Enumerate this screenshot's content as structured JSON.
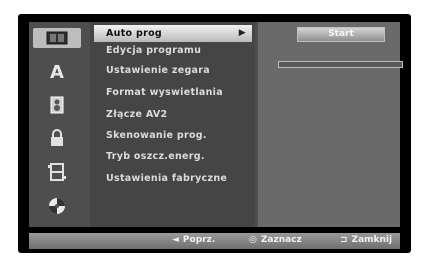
{
  "icons": [
    {
      "name": "disc-icon",
      "glyph": "▥",
      "selected": true
    },
    {
      "name": "language-icon",
      "glyph": "A",
      "selected": false
    },
    {
      "name": "audio-icon",
      "glyph": "♪",
      "selected": false
    },
    {
      "name": "lock-icon",
      "glyph": "🔒",
      "selected": false
    },
    {
      "name": "recording-icon",
      "glyph": "⧉",
      "selected": false
    },
    {
      "name": "dvd-icon",
      "glyph": "⊛",
      "selected": false
    }
  ],
  "menu": {
    "items": [
      {
        "label": "Auto prog",
        "selected": true
      },
      {
        "label": "Edycja programu",
        "selected": false
      },
      {
        "label": "Ustawienie zegara",
        "selected": false
      },
      {
        "label": "Format wyswietlania",
        "selected": false
      },
      {
        "label": "Złącze AV2",
        "selected": false
      },
      {
        "label": "Skenowanie prog.",
        "selected": false
      },
      {
        "label": "Tryb oszcz.energ.",
        "selected": false
      },
      {
        "label": "Ustawienia fabryczne",
        "selected": false
      }
    ],
    "submenu_arrow": "▶"
  },
  "right": {
    "start_label": "Start",
    "progress": 0
  },
  "bottom": {
    "prev_symbol": "◄",
    "prev_label": "Poprz.",
    "select_symbol": "◎",
    "select_label": "Zaznacz",
    "close_symbol": "⊐",
    "close_label": "Zamknij"
  },
  "colors": {
    "panel": "#4e4e4e",
    "selected_item": "#d9d9d9",
    "bottom_bar": "#858585"
  }
}
